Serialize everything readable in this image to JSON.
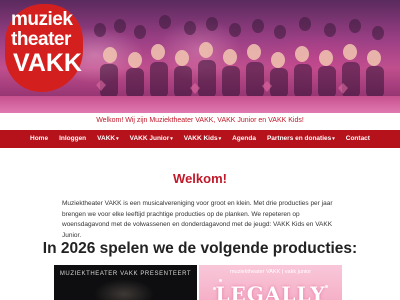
{
  "logo": {
    "line1": "muziek",
    "line2": "theater",
    "line3": "VAKK"
  },
  "welcome_banner": "Welkom! Wij zijn Muziektheater VAKK, VAKK Junior en VAKK Kids!",
  "nav": {
    "items": [
      {
        "label": "Home",
        "has_dropdown": false
      },
      {
        "label": "Inloggen",
        "has_dropdown": false
      },
      {
        "label": "VAKK",
        "has_dropdown": true
      },
      {
        "label": "VAKK Junior",
        "has_dropdown": true
      },
      {
        "label": "VAKK Kids",
        "has_dropdown": true
      },
      {
        "label": "Agenda",
        "has_dropdown": false
      },
      {
        "label": "Partners en donaties",
        "has_dropdown": true
      },
      {
        "label": "Contact",
        "has_dropdown": false
      }
    ]
  },
  "main": {
    "title": "Welkom!",
    "intro": "Muziektheater VAKK is een musicalvereniging voor groot en klein. Met drie producties per jaar brengen we voor elke leeftijd prachtige producties op de planken. We repeteren op woensdagavond met de volwassenen en donderdagavond met de jeugd: VAKK Kids en VAKK Junior.",
    "subheading": "In 2026 spelen we de volgende producties:"
  },
  "posters": [
    {
      "caption": "MUZIEKTHEATER VAKK PRESENTEERT"
    },
    {
      "caption": "muziektheater VAKK | vakk junior",
      "title": "LEGALLY"
    }
  ],
  "colors": {
    "brand_red": "#b5121b",
    "logo_red": "#d3201f",
    "heading_red": "#c0192a",
    "hero_magenta": "#c04f8e"
  },
  "icons": {
    "dropdown": "caret-down-icon"
  }
}
